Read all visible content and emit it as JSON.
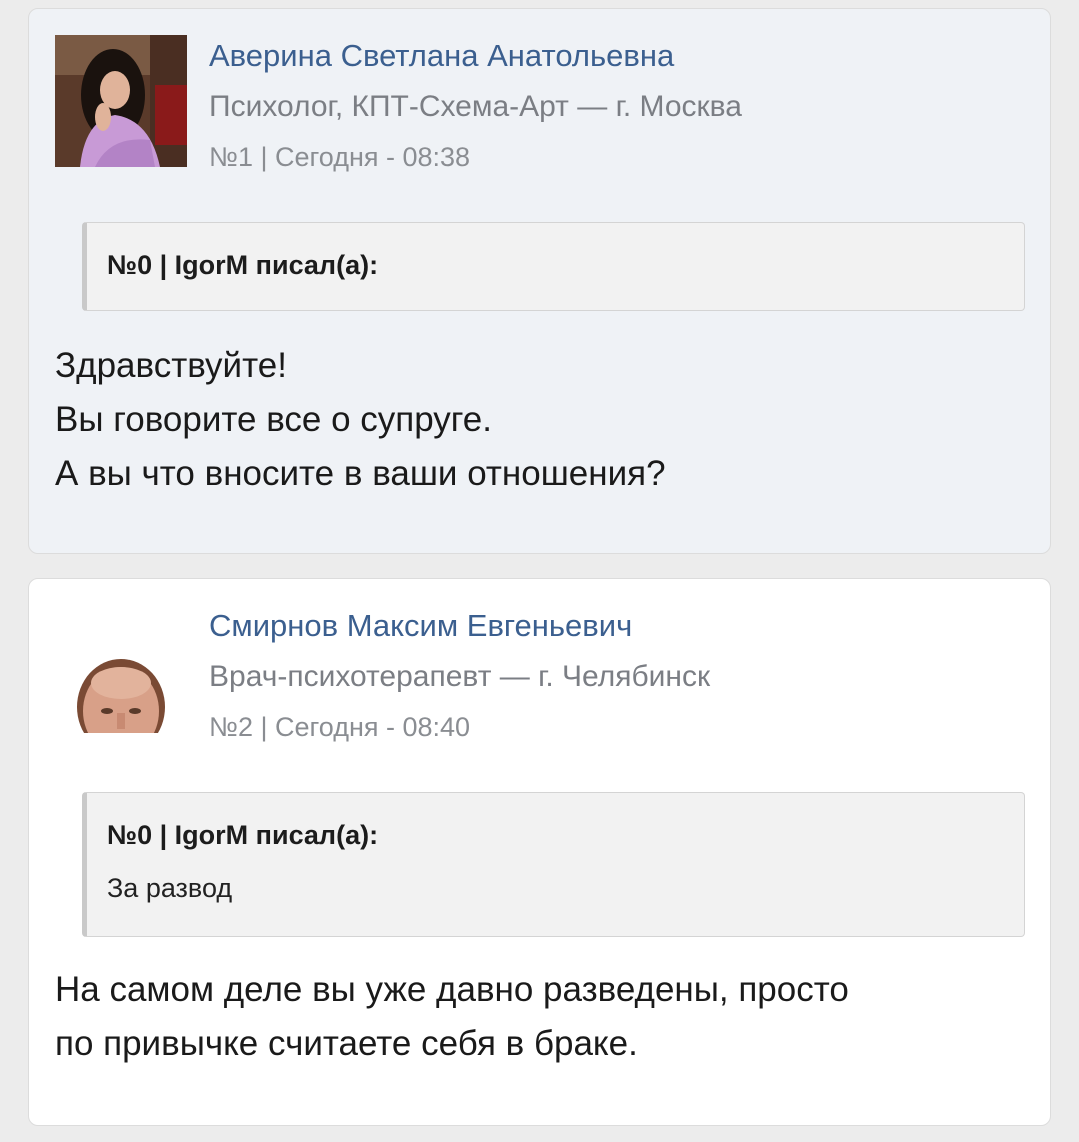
{
  "posts": [
    {
      "author": "Аверина Светлана Анатольевна",
      "meta": "Психолог, КПТ-Схема-Арт — г. Москва",
      "info": "№1 | Сегодня - 08:38",
      "quote": {
        "head": "№0 | IgorM писал(а):",
        "body": ""
      },
      "lines": [
        "Здравствуйте!",
        "Вы говорите все о супруге.",
        "А вы что вносите в ваши отношения?"
      ]
    },
    {
      "author": "Смирнов Максим Евгеньевич",
      "meta": "Врач-психотерапевт — г. Челябинск",
      "info": "№2 | Сегодня - 08:40",
      "quote": {
        "head": "№0 | IgorM писал(а):",
        "body": "За развод"
      },
      "lines": [
        "На самом деле вы уже давно разведены, просто",
        "по привычке считаете себя в браке."
      ]
    }
  ],
  "colors": {
    "page_bg": "#ececec",
    "post_highlight_bg": "#eff2f6",
    "post_bg": "#ffffff",
    "author_link": "#3b5f8f",
    "meta_text": "#7b7e84",
    "quote_bg": "#f2f2f2"
  },
  "icons": {
    "avatar_1": "woman-portrait-photo",
    "avatar_2": "man-portrait-photo"
  }
}
